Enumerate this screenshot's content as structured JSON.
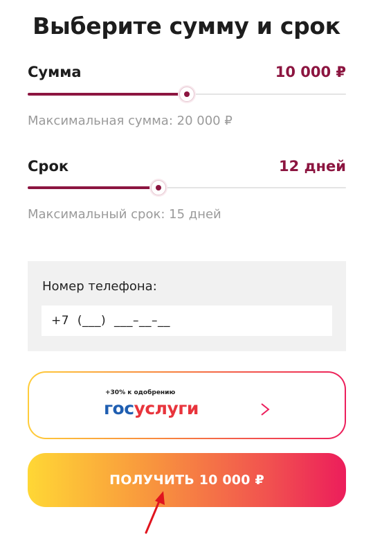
{
  "title": "Выберите сумму и срок",
  "amount": {
    "label": "Сумма",
    "value": "10 000 ₽",
    "slider_level": 0.5,
    "hint": "Максимальная сумма: 20 000 ₽"
  },
  "term": {
    "label": "Срок",
    "value": "12 дней",
    "slider_level": 0.41,
    "hint": "Максимальный срок: 15 дней"
  },
  "phone": {
    "label": "Номер телефона:",
    "placeholder": "+7  (___)  ___–__–__"
  },
  "gosuslugi": {
    "note": "+30% к одобрению",
    "logo_part1": "гос",
    "logo_part2": "услуги",
    "arrow_icon": "arrow-right-icon"
  },
  "submit": {
    "label": "ПОЛУЧИТЬ 10 000 ₽"
  },
  "colors": {
    "accent": "#8c1540",
    "gos_blue": "#1f5eb1",
    "gos_red": "#e8343c",
    "gradient_start": "#ffd735",
    "gradient_end": "#ec1d5b",
    "pointer_arrow": "#e0141e"
  }
}
